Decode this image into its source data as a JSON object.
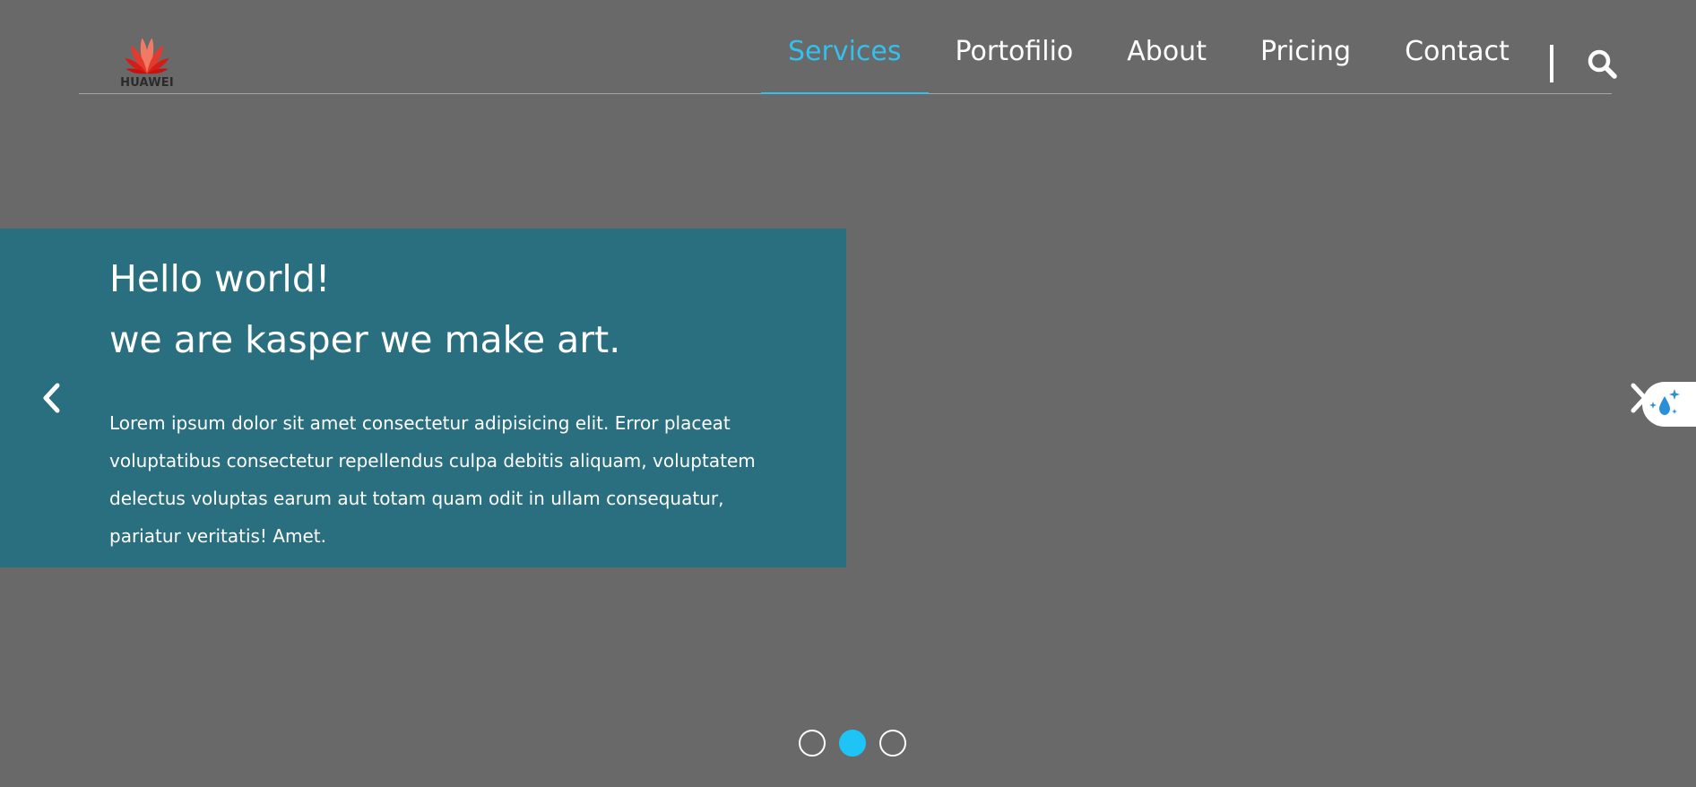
{
  "brand": {
    "name": "HUAWEI",
    "logo_color": "#e0221b"
  },
  "nav": {
    "items": [
      {
        "label": "Services",
        "active": true
      },
      {
        "label": "Portofilio",
        "active": false
      },
      {
        "label": "About",
        "active": false
      },
      {
        "label": "Pricing",
        "active": false
      },
      {
        "label": "Contact",
        "active": false
      }
    ],
    "active_color": "#33c0ec",
    "search_icon": "search-icon"
  },
  "hero": {
    "title_line1": "Hello world!",
    "title_line2": "we are kasper we make art.",
    "body": "Lorem ipsum dolor sit amet consectetur adipisicing elit. Error placeat voluptatibus consectetur repellendus culpa debitis aliquam, voluptatem delectus voluptas earum aut totam quam odit in ullam consequatur, pariatur veritatis! Amet.",
    "panel_color": "#296f80",
    "prev_icon": "chevron-left-icon",
    "next_icon": "chevron-right-icon"
  },
  "pagination": {
    "total": 3,
    "active_index": 1,
    "active_color": "#1ec4f6"
  },
  "colors": {
    "background": "#696969",
    "divider": "#a6a6a6"
  }
}
